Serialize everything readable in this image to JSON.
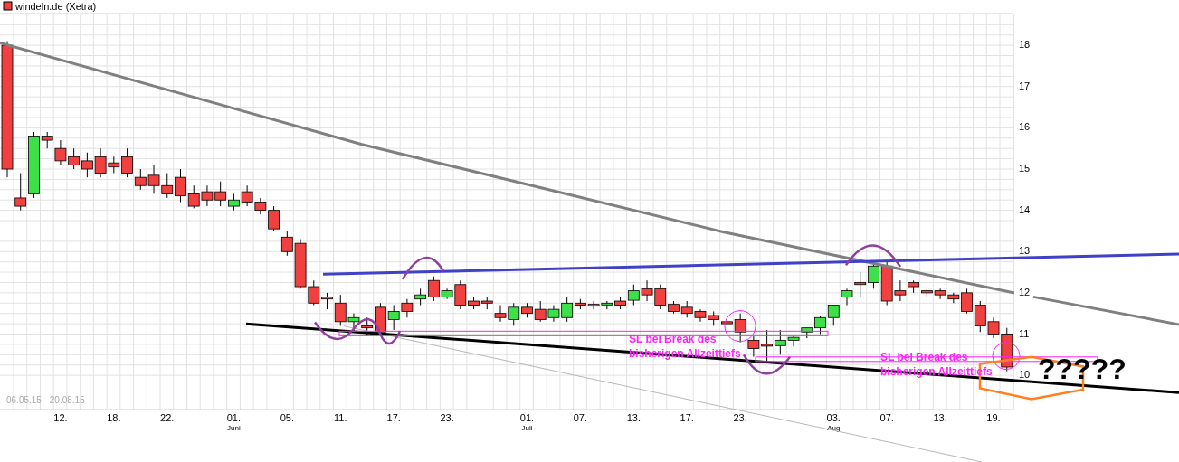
{
  "legend": {
    "label": "windeln.de (Xetra)",
    "color": "#f04040"
  },
  "date_range": "06.05.15 - 20.08.15",
  "chart_data": {
    "type": "candlestick",
    "grid": true,
    "ylim": [
      9.17,
      18.77
    ],
    "yticks": [
      18,
      17,
      16,
      15,
      14,
      13,
      12,
      11,
      10
    ],
    "categories": [
      null,
      null,
      null,
      null,
      "12.",
      null,
      null,
      null,
      "18.",
      null,
      null,
      null,
      "22.",
      null,
      null,
      null,
      null,
      "01.",
      null,
      null,
      null,
      "05.",
      null,
      null,
      null,
      "11.",
      null,
      null,
      null,
      "17.",
      null,
      null,
      null,
      "23.",
      null,
      null,
      null,
      null,
      null,
      "01.",
      null,
      null,
      null,
      "07.",
      null,
      null,
      null,
      "13.",
      null,
      null,
      null,
      "17.",
      null,
      null,
      null,
      "23.",
      null,
      null,
      null,
      null,
      null,
      null,
      "03.",
      null,
      null,
      null,
      "07.",
      null,
      null,
      null,
      "13.",
      null,
      null,
      null,
      "19.",
      null
    ],
    "ohlc": [
      [
        18,
        18.1,
        14.8,
        15
      ],
      [
        14.3,
        14.9,
        14.0,
        14.1
      ],
      [
        14.4,
        15.9,
        14.3,
        15.8
      ],
      [
        15.8,
        15.9,
        15.5,
        15.7
      ],
      [
        15.5,
        15.7,
        15.1,
        15.2
      ],
      [
        15.3,
        15.5,
        15.0,
        15.1
      ],
      [
        15.2,
        15.4,
        14.8,
        15.0
      ],
      [
        15.3,
        15.5,
        14.8,
        14.9
      ],
      [
        15.15,
        15.3,
        14.9,
        15.05
      ],
      [
        15.3,
        15.5,
        14.8,
        14.9
      ],
      [
        14.8,
        15.0,
        14.5,
        14.6
      ],
      [
        14.85,
        15.1,
        14.4,
        14.6
      ],
      [
        14.6,
        14.9,
        14.3,
        14.4
      ],
      [
        14.8,
        15.0,
        14.2,
        14.35
      ],
      [
        14.4,
        14.6,
        14.05,
        14.1
      ],
      [
        14.45,
        14.6,
        14.1,
        14.25
      ],
      [
        14.45,
        14.7,
        14.1,
        14.25
      ],
      [
        14.1,
        14.4,
        14.0,
        14.25
      ],
      [
        14.45,
        14.6,
        14.1,
        14.2
      ],
      [
        14.2,
        14.3,
        13.9,
        14.0
      ],
      [
        14.0,
        14.1,
        13.5,
        13.55
      ],
      [
        13.35,
        13.5,
        12.9,
        13.0
      ],
      [
        13.2,
        13.3,
        12.1,
        12.15
      ],
      [
        12.15,
        12.3,
        11.7,
        11.75
      ],
      [
        11.9,
        12.0,
        11.6,
        11.85
      ],
      [
        11.75,
        11.95,
        11.2,
        11.3
      ],
      [
        11.3,
        11.5,
        11.05,
        11.4
      ],
      [
        11.2,
        11.4,
        10.95,
        11.15
      ],
      [
        11.65,
        11.75,
        11.0,
        11.05
      ],
      [
        11.35,
        11.7,
        11.1,
        11.55
      ],
      [
        11.75,
        11.85,
        11.4,
        11.55
      ],
      [
        11.85,
        12.1,
        11.7,
        11.95
      ],
      [
        12.3,
        12.4,
        11.8,
        11.9
      ],
      [
        11.9,
        12.1,
        11.85,
        12.05
      ],
      [
        12.2,
        12.3,
        11.6,
        11.7
      ],
      [
        11.8,
        11.9,
        11.6,
        11.7
      ],
      [
        11.8,
        11.9,
        11.6,
        11.75
      ],
      [
        11.5,
        11.7,
        11.3,
        11.4
      ],
      [
        11.35,
        11.75,
        11.2,
        11.65
      ],
      [
        11.65,
        11.75,
        11.4,
        11.5
      ],
      [
        11.6,
        11.8,
        11.3,
        11.35
      ],
      [
        11.4,
        11.7,
        11.3,
        11.6
      ],
      [
        11.4,
        11.9,
        11.3,
        11.75
      ],
      [
        11.75,
        11.85,
        11.6,
        11.7
      ],
      [
        11.72,
        11.8,
        11.6,
        11.7
      ],
      [
        11.72,
        11.8,
        11.6,
        11.75
      ],
      [
        11.8,
        11.9,
        11.6,
        11.7
      ],
      [
        11.82,
        12.2,
        11.7,
        12.05
      ],
      [
        12.1,
        12.3,
        11.8,
        11.95
      ],
      [
        12.1,
        12.2,
        11.6,
        11.7
      ],
      [
        11.72,
        11.8,
        11.5,
        11.55
      ],
      [
        11.65,
        11.8,
        11.4,
        11.5
      ],
      [
        11.55,
        11.6,
        11.3,
        11.4
      ],
      [
        11.45,
        11.55,
        11.2,
        11.35
      ],
      [
        11.3,
        11.35,
        11.1,
        11.25
      ],
      [
        11.35,
        11.5,
        10.8,
        11.05
      ],
      [
        10.85,
        10.95,
        10.45,
        10.65
      ],
      [
        10.75,
        11.1,
        10.3,
        10.72
      ],
      [
        10.72,
        11.1,
        10.5,
        10.85
      ],
      [
        10.85,
        10.95,
        10.7,
        10.92
      ],
      [
        11.05,
        11.15,
        10.9,
        11.15
      ],
      [
        11.15,
        11.45,
        11.0,
        11.4
      ],
      [
        11.4,
        11.7,
        11.2,
        11.7
      ],
      [
        11.9,
        12.1,
        11.7,
        12.05
      ],
      [
        12.25,
        12.5,
        11.9,
        12.2
      ],
      [
        12.25,
        12.75,
        12.1,
        12.65
      ],
      [
        12.65,
        12.75,
        11.7,
        11.8
      ],
      [
        12.05,
        12.3,
        11.8,
        11.95
      ],
      [
        12.25,
        12.3,
        12.0,
        12.15
      ],
      [
        12.05,
        12.1,
        11.9,
        12.0
      ],
      [
        12.05,
        12.1,
        11.85,
        11.95
      ],
      [
        11.95,
        12.0,
        11.75,
        11.85
      ],
      [
        12.0,
        12.1,
        11.5,
        11.55
      ],
      [
        11.7,
        11.8,
        11.05,
        11.2
      ],
      [
        11.3,
        11.4,
        10.9,
        11.0
      ],
      [
        11.0,
        11.15,
        10.1,
        10.2
      ]
    ]
  },
  "month_labels": [
    {
      "label": "Juni"
    },
    {
      "label": "Juli"
    },
    {
      "label": "Aug"
    }
  ],
  "annotations": [
    {
      "lines": [
        "SL bei Break des",
        "bisherigen Allzeittiefs"
      ]
    },
    {
      "lines": [
        "SL bei Break des",
        "bisherigen Allzeittiefs"
      ]
    }
  ],
  "question_text": "?????"
}
